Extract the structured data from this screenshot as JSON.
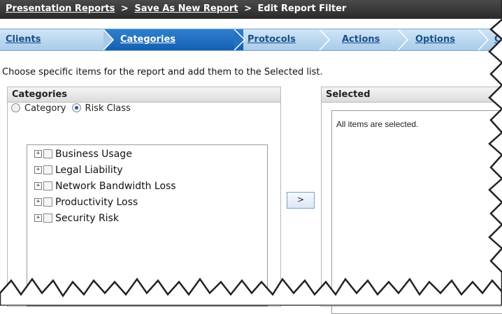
{
  "breadcrumb": {
    "items": [
      "Presentation Reports",
      "Save As New Report",
      "Edit Report Filter"
    ],
    "separator": ">"
  },
  "wizard": {
    "steps": [
      "Clients",
      "Categories",
      "Protocols",
      "Actions",
      "Options",
      "C"
    ],
    "active": "Categories"
  },
  "instructions": "Choose specific items for the report and add them to the Selected list.",
  "categories_panel": {
    "title": "Categories",
    "radio_category": "Category",
    "radio_risk_class": "Risk Class",
    "selected_radio": "Risk Class",
    "tree_items": [
      "Business Usage",
      "Legal Liability",
      "Network Bandwidth Loss",
      "Productivity Loss",
      "Security Risk"
    ],
    "expand_glyph": "+"
  },
  "add_button": ">",
  "selected_panel": {
    "title": "Selected",
    "message": "All items are selected."
  }
}
